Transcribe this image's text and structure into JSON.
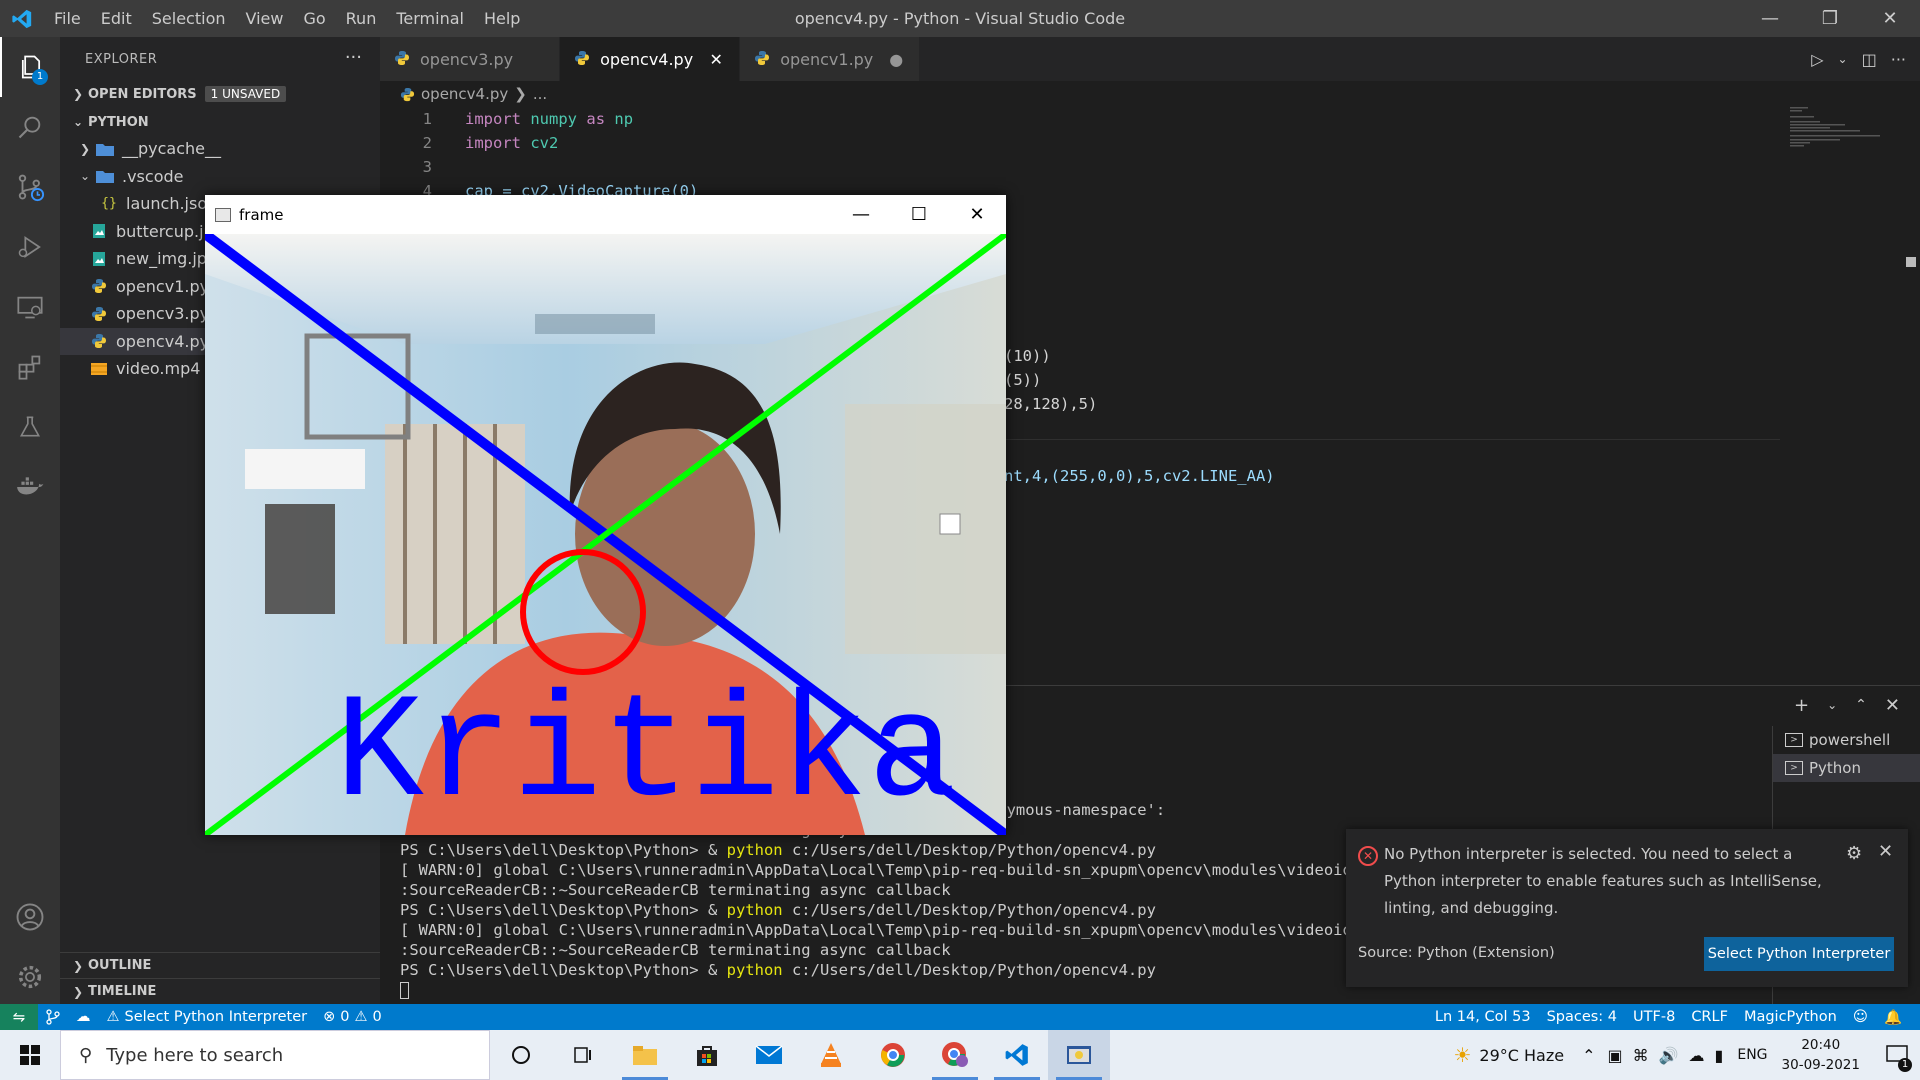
{
  "window": {
    "title": "opencv4.py - Python - Visual Studio Code",
    "menu": [
      "File",
      "Edit",
      "Selection",
      "View",
      "Go",
      "Run",
      "Terminal",
      "Help"
    ]
  },
  "activity_bar": {
    "explorer_badge": "1"
  },
  "sidebar": {
    "title": "EXPLORER",
    "open_editors": {
      "label": "OPEN EDITORS",
      "badge": "1 UNSAVED"
    },
    "folder": "PYTHON",
    "items": [
      {
        "label": "__pycache__",
        "kind": "folder",
        "expanded": false
      },
      {
        "label": ".vscode",
        "kind": "folder",
        "expanded": true
      },
      {
        "label": "launch.json",
        "kind": "json"
      },
      {
        "label": "buttercup.jpg",
        "kind": "image"
      },
      {
        "label": "new_img.jpg",
        "kind": "image"
      },
      {
        "label": "opencv1.py",
        "kind": "python"
      },
      {
        "label": "opencv3.py",
        "kind": "python"
      },
      {
        "label": "opencv4.py",
        "kind": "python",
        "selected": true
      },
      {
        "label": "video.mp4",
        "kind": "video"
      }
    ],
    "outline": "OUTLINE",
    "timeline": "TIMELINE"
  },
  "tabs": [
    {
      "label": "opencv3.py",
      "active": false
    },
    {
      "label": "opencv4.py",
      "active": true,
      "close": "✕"
    },
    {
      "label": "opencv1.py",
      "active": false,
      "dirty": "●"
    }
  ],
  "breadcrumb": {
    "file": "opencv4.py",
    "rest": "..."
  },
  "code": {
    "lines": [
      {
        "n": "1",
        "kw": "import",
        "mod": "numpy",
        "as": "as",
        "alias": "np"
      },
      {
        "n": "2",
        "kw": "import",
        "mod": "cv2"
      },
      {
        "n": "3"
      },
      {
        "n": "4",
        "text": "cap = cv2.VideoCapture(0)"
      }
    ],
    "fragments": [
      "(10))",
      "(5))",
      "28,128),5)",
      "nt,4,(255,0,0),5,cv2.LINE_AA)"
    ]
  },
  "panel": {
    "terminals": [
      "powershell",
      "Python"
    ],
    "lines": [
      "uild-sn_xpupm\\opencv\\modules\\videoio\\src\\cap_msmf.cpp (438) `anonymous-namespace':",
      ":SourceReaderCB::~SourceReaderCB terminating async callback",
      "PS C:\\Users\\dell\\Desktop\\Python> & python c:/Users/dell/Desktop/Python/opencv4.py",
      "[ WARN:0] global C:\\Users\\runneradmin\\AppData\\Local\\Temp\\pip-req-build-sn_xpupm\\opencv\\modules\\videoio\\sr",
      ":SourceReaderCB::~SourceReaderCB terminating async callback",
      "PS C:\\Users\\dell\\Desktop\\Python> & python c:/Users/dell/Desktop/Python/opencv4.py",
      "[ WARN:0] global C:\\Users\\runneradmin\\AppData\\Local\\Temp\\pip-req-build-sn_xpupm\\opencv\\modules\\videoio\\sr",
      ":SourceReaderCB::~SourceReaderCB terminating async callback",
      "PS C:\\Users\\dell\\Desktop\\Python> & python c:/Users/dell/Desktop/Python/opencv4.py"
    ],
    "prompt_prefix": "PS C:\\Users\\dell\\Desktop\\Python> & ",
    "prompt_cmd": "python",
    "prompt_arg": " c:/Users/dell/Desktop/Python/opencv4.py"
  },
  "notification": {
    "message": "No Python interpreter is selected. You need to select a Python interpreter to enable features such as IntelliSense, linting, and debugging.",
    "source": "Source: Python (Extension)",
    "button": "Select Python Interpreter"
  },
  "statusbar": {
    "interpreter": "Select Python Interpreter",
    "errors": "0",
    "warnings": "0",
    "position": "Ln 14, Col 53",
    "spaces": "Spaces: 4",
    "encoding": "UTF-8",
    "eol": "CRLF",
    "language": "MagicPython"
  },
  "frame_window": {
    "title": "frame",
    "overlay_text": "Kritika",
    "colors": {
      "blue_line": "#0000ff",
      "green_line": "#00ff00",
      "red_circle": "#ff0000",
      "text": "#0000ff",
      "gray_box": "#808080"
    }
  },
  "taskbar": {
    "search_placeholder": "Type here to search",
    "weather": "29°C  Haze",
    "language": "ENG",
    "time": "20:40",
    "date": "30-09-2021",
    "notifications": "1"
  },
  "colors": {
    "accent": "#007acc",
    "remote": "#16825d",
    "button": "#0e639c"
  }
}
